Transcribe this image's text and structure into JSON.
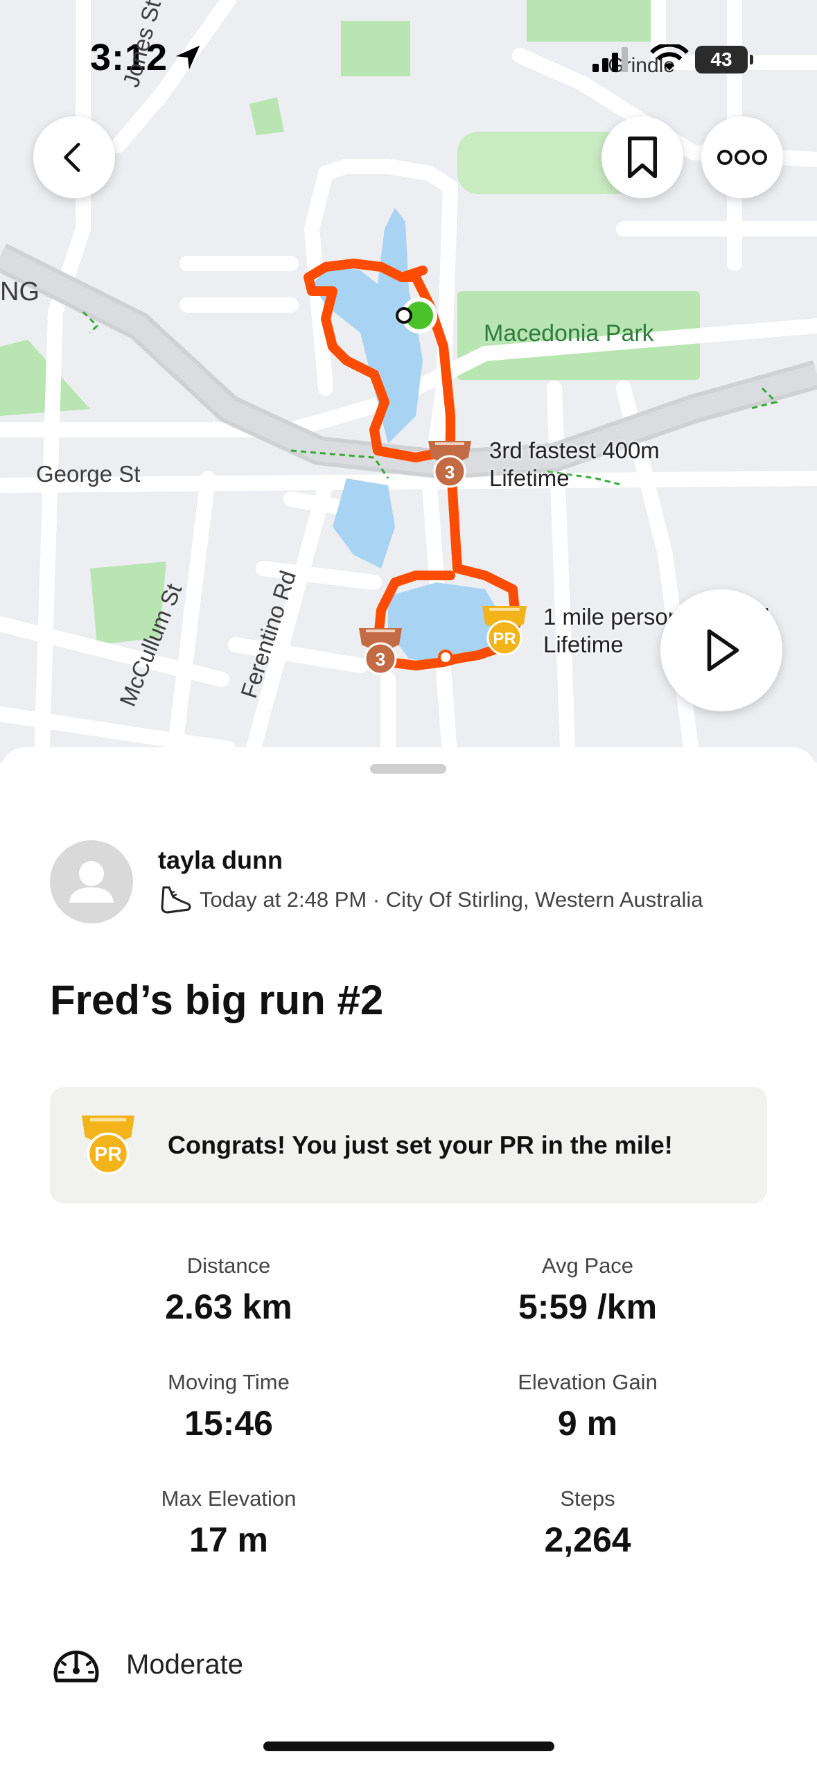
{
  "status_bar": {
    "time": "3:12",
    "carrier": "Grindle",
    "battery": "43"
  },
  "map": {
    "street_labels": [
      "Jones St",
      "George St",
      "McCullum St",
      "Ferentino Rd",
      "NG"
    ],
    "park_label": "Macedonia Park",
    "annotations": [
      {
        "line1": "3rd fastest 400m",
        "line2": "Lifetime"
      },
      {
        "line1": "1 mile personal record",
        "line2": "Lifetime"
      }
    ],
    "medals": [
      {
        "type": "bronze",
        "text": "3"
      },
      {
        "type": "bronze",
        "text": "3"
      },
      {
        "type": "gold",
        "text": "PR"
      }
    ],
    "colors": {
      "route": "#FC4C02",
      "water": "#a8d3f2",
      "park": "#b9e5b2",
      "gold": "#F2B31B",
      "bronze": "#C26B45"
    }
  },
  "buttons": {
    "back_icon": "chevron-left-icon",
    "bookmark_icon": "bookmark-icon",
    "more_icon": "more-icon",
    "play_icon": "play-icon"
  },
  "activity": {
    "user_name": "tayla dunn",
    "meta": "Today at 2:48 PM · City Of Stirling, Western Australia",
    "title": "Fred’s big run #2",
    "pr_banner": {
      "medal_text": "PR",
      "message": "Congrats! You just set your PR in the mile!"
    },
    "stats": [
      {
        "label": "Distance",
        "value": "2.63 km"
      },
      {
        "label": "Avg Pace",
        "value": "5:59 /km"
      },
      {
        "label": "Moving Time",
        "value": "15:46"
      },
      {
        "label": "Elevation Gain",
        "value": "9 m"
      },
      {
        "label": "Max Elevation",
        "value": "17 m"
      },
      {
        "label": "Steps",
        "value": "2,264"
      }
    ],
    "effort": "Moderate"
  }
}
